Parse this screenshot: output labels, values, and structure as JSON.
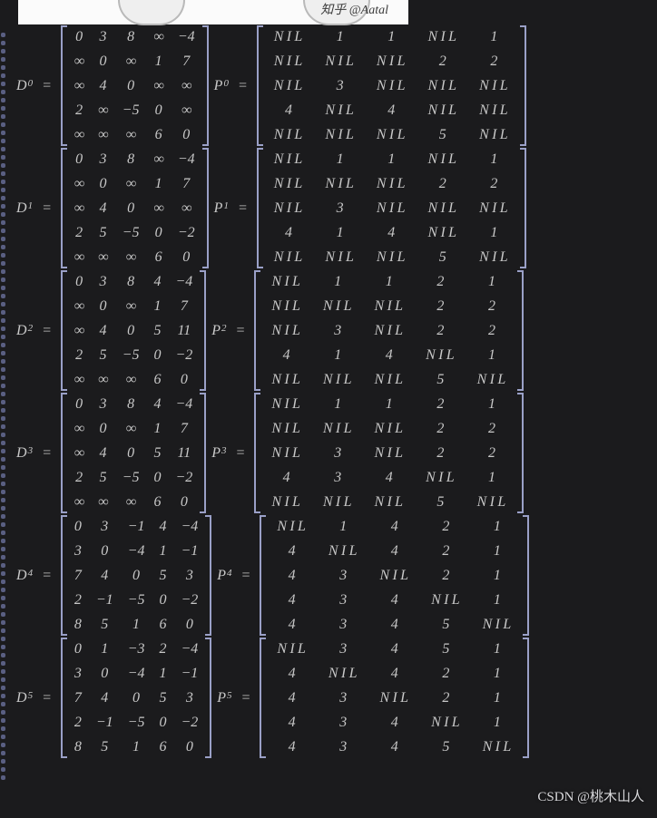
{
  "header": {
    "zhihu_tag": "知乎 @Aatal"
  },
  "watermark": "CSDN @桃木山人",
  "nil": "NIL",
  "inf": "∞",
  "eq": "=",
  "labels": {
    "D": "D",
    "P": "P"
  },
  "chart_data": [
    {
      "type": "table",
      "title": "D^0",
      "D": [
        [
          0,
          3,
          8,
          "∞",
          -4
        ],
        [
          "∞",
          0,
          "∞",
          1,
          7
        ],
        [
          "∞",
          4,
          0,
          "∞",
          "∞"
        ],
        [
          2,
          "∞",
          -5,
          0,
          "∞"
        ],
        [
          "∞",
          "∞",
          "∞",
          6,
          0
        ]
      ],
      "P_title": "P^0",
      "P": [
        [
          "NIL",
          1,
          1,
          "NIL",
          1
        ],
        [
          "NIL",
          "NIL",
          "NIL",
          2,
          2
        ],
        [
          "NIL",
          3,
          "NIL",
          "NIL",
          "NIL"
        ],
        [
          4,
          "NIL",
          4,
          "NIL",
          "NIL"
        ],
        [
          "NIL",
          "NIL",
          "NIL",
          5,
          "NIL"
        ]
      ]
    },
    {
      "type": "table",
      "title": "D^1",
      "D": [
        [
          0,
          3,
          8,
          "∞",
          -4
        ],
        [
          "∞",
          0,
          "∞",
          1,
          7
        ],
        [
          "∞",
          4,
          0,
          "∞",
          "∞"
        ],
        [
          2,
          5,
          -5,
          0,
          -2
        ],
        [
          "∞",
          "∞",
          "∞",
          6,
          0
        ]
      ],
      "P_title": "P^1",
      "P": [
        [
          "NIL",
          1,
          1,
          "NIL",
          1
        ],
        [
          "NIL",
          "NIL",
          "NIL",
          2,
          2
        ],
        [
          "NIL",
          3,
          "NIL",
          "NIL",
          "NIL"
        ],
        [
          4,
          1,
          4,
          "NIL",
          1
        ],
        [
          "NIL",
          "NIL",
          "NIL",
          5,
          "NIL"
        ]
      ]
    },
    {
      "type": "table",
      "title": "D^2",
      "D": [
        [
          0,
          3,
          8,
          4,
          -4
        ],
        [
          "∞",
          0,
          "∞",
          1,
          7
        ],
        [
          "∞",
          4,
          0,
          5,
          11
        ],
        [
          2,
          5,
          -5,
          0,
          -2
        ],
        [
          "∞",
          "∞",
          "∞",
          6,
          0
        ]
      ],
      "P_title": "P^2",
      "P": [
        [
          "NIL",
          1,
          1,
          2,
          1
        ],
        [
          "NIL",
          "NIL",
          "NIL",
          2,
          2
        ],
        [
          "NIL",
          3,
          "NIL",
          2,
          2
        ],
        [
          4,
          1,
          4,
          "NIL",
          1
        ],
        [
          "NIL",
          "NIL",
          "NIL",
          5,
          "NIL"
        ]
      ]
    },
    {
      "type": "table",
      "title": "D^3",
      "D": [
        [
          0,
          3,
          8,
          4,
          -4
        ],
        [
          "∞",
          0,
          "∞",
          1,
          7
        ],
        [
          "∞",
          4,
          0,
          5,
          11
        ],
        [
          2,
          5,
          -5,
          0,
          -2
        ],
        [
          "∞",
          "∞",
          "∞",
          6,
          0
        ]
      ],
      "P_title": "P^3",
      "P": [
        [
          "NIL",
          1,
          1,
          2,
          1
        ],
        [
          "NIL",
          "NIL",
          "NIL",
          2,
          2
        ],
        [
          "NIL",
          3,
          "NIL",
          2,
          2
        ],
        [
          4,
          3,
          4,
          "NIL",
          1
        ],
        [
          "NIL",
          "NIL",
          "NIL",
          5,
          "NIL"
        ]
      ]
    },
    {
      "type": "table",
      "title": "D^4",
      "D": [
        [
          0,
          3,
          -1,
          4,
          -4
        ],
        [
          3,
          0,
          -4,
          1,
          -1
        ],
        [
          7,
          4,
          0,
          5,
          3
        ],
        [
          2,
          -1,
          -5,
          0,
          -2
        ],
        [
          8,
          5,
          1,
          6,
          0
        ]
      ],
      "P_title": "P^4",
      "P": [
        [
          "NIL",
          1,
          4,
          2,
          1
        ],
        [
          4,
          "NIL",
          4,
          2,
          1
        ],
        [
          4,
          3,
          "NIL",
          2,
          1
        ],
        [
          4,
          3,
          4,
          "NIL",
          1
        ],
        [
          4,
          3,
          4,
          5,
          "NIL"
        ]
      ]
    },
    {
      "type": "table",
      "title": "D^5",
      "D": [
        [
          0,
          1,
          -3,
          2,
          -4
        ],
        [
          3,
          0,
          -4,
          1,
          -1
        ],
        [
          7,
          4,
          0,
          5,
          3
        ],
        [
          2,
          -1,
          -5,
          0,
          -2
        ],
        [
          8,
          5,
          1,
          6,
          0
        ]
      ],
      "P_title": "P^5",
      "P": [
        [
          "NIL",
          3,
          4,
          5,
          1
        ],
        [
          4,
          "NIL",
          4,
          2,
          1
        ],
        [
          4,
          3,
          "NIL",
          2,
          1
        ],
        [
          4,
          3,
          4,
          "NIL",
          1
        ],
        [
          4,
          3,
          4,
          5,
          "NIL"
        ]
      ]
    }
  ]
}
